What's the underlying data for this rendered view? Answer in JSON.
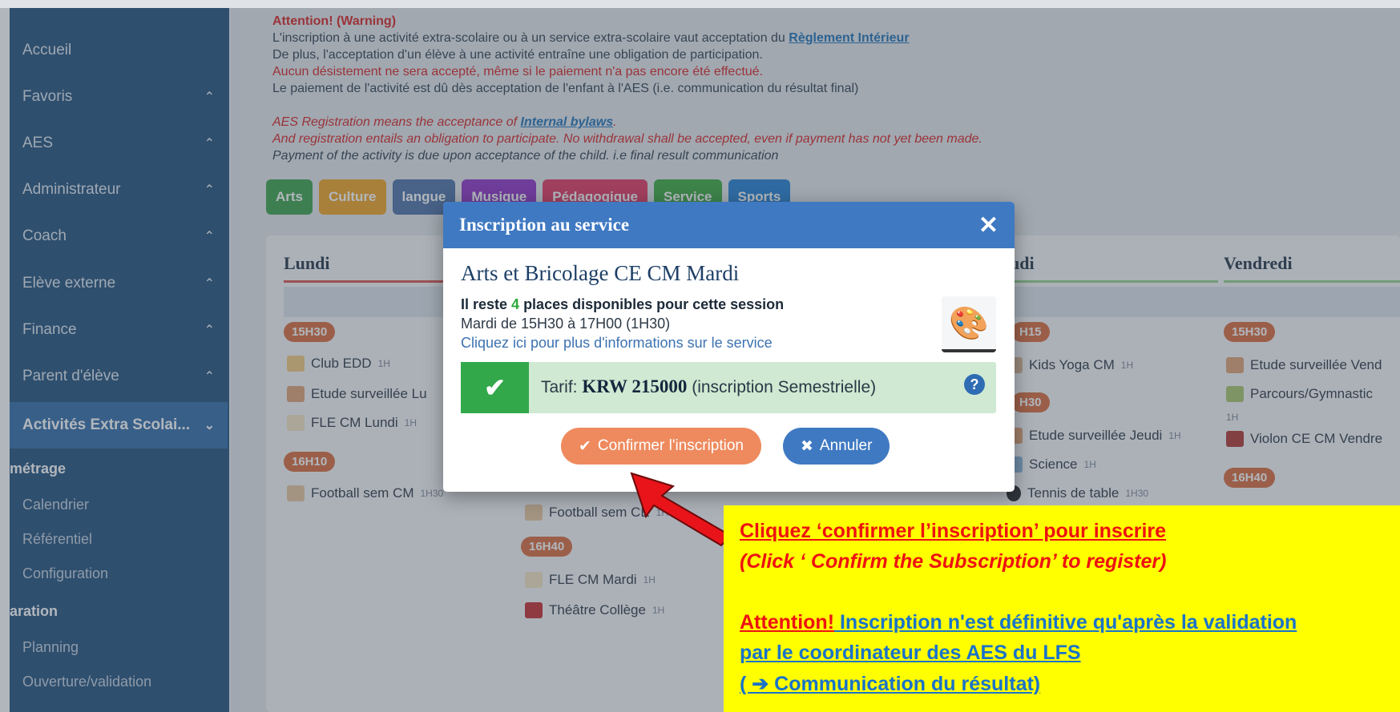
{
  "sidebar": {
    "items": [
      {
        "label": "Accueil",
        "chevron": ""
      },
      {
        "label": "Favoris",
        "chevron": "^"
      },
      {
        "label": "AES",
        "chevron": "^"
      },
      {
        "label": "Administrateur",
        "chevron": "^"
      },
      {
        "label": "Coach",
        "chevron": "^"
      },
      {
        "label": "Elève externe",
        "chevron": "^"
      },
      {
        "label": "Finance",
        "chevron": "^"
      },
      {
        "label": "Parent d'élève",
        "chevron": "^"
      },
      {
        "label": "Activités Extra Scolai...",
        "chevron": "v"
      }
    ],
    "section1": "métrage",
    "sub1": [
      "Calendrier",
      "Référentiel",
      "Configuration"
    ],
    "section2": "aration",
    "sub2": [
      "Planning",
      "Ouverture/validation"
    ]
  },
  "notice": {
    "title": "Attention! (Warning)",
    "line1": "L'inscription à une activité extra-scolaire ou à un service extra-scolaire vaut acceptation du ",
    "line1_link": "Règlement Intérieur",
    "line2": "De plus, l'acceptation d'un élève à une activité entraîne une obligation de participation.",
    "line3": "Aucun désistement ne sera accepté, même si le paiement n'a pas encore été effectué.",
    "line4": "Le paiement de l'activité est dû dès acceptation de l'enfant à l'AES (i.e. communication du résultat final)",
    "en1": "AES Registration means the acceptance of ",
    "en1_link": "Internal bylaws",
    "en1_end": ".",
    "en2": "And registration entails an obligation to participate. No withdrawal shall be accepted, even if payment has not yet been made.",
    "en3": "Payment of the activity is due upon acceptance of the child. i.e final result communication"
  },
  "tabs": [
    {
      "label": "Arts",
      "color": "#3aa047"
    },
    {
      "label": "Culture",
      "color": "#f0a21e"
    },
    {
      "label": "langue",
      "color": "#4a6fa5"
    },
    {
      "label": "Musique",
      "color": "#8e2fc4"
    },
    {
      "label": "Pédagogique",
      "color": "#e2345f"
    },
    {
      "label": "Service",
      "color": "#37a83c"
    },
    {
      "label": "Sports",
      "color": "#1f7fd3"
    }
  ],
  "schedule": {
    "lundi": "Lundi",
    "jeudi": "udi",
    "vendredi": "Vendredi",
    "times": {
      "l1": "15H30",
      "l2": "16H10",
      "m1": "16H40",
      "j1": "H15",
      "j2": "H30",
      "v1": "15H30",
      "v2": "16H40"
    },
    "activities": {
      "club_edd": "Club EDD",
      "club_edd_d": "1H",
      "etude_lu": "Etude surveillée Lu",
      "fle_lundi": "FLE CM Lundi",
      "fle_lundi_d": "1H",
      "football_lu": "Football sem CM",
      "football_lu_d": "1H30",
      "football_ma": "Football sem CE",
      "football_ma_d": "1H30",
      "fle_mardi": "FLE CM Mardi",
      "fle_mardi_d": "1H",
      "theatre": "Théâtre Collège",
      "theatre_d": "1H",
      "yoga": "Kids Yoga CM",
      "yoga_d": "1H",
      "etude_jeudi": "Etude surveillée Jeudi",
      "etude_jeudi_d": "1H",
      "science": "Science",
      "science_d": "1H",
      "tennis": "Tennis de table",
      "tennis_d": "1H30",
      "etude_vend": "Etude surveillée Vend",
      "parcours": "Parcours/Gymnastic",
      "parcours_d": "1H",
      "violon": "Violon CE CM Vendre"
    }
  },
  "modal": {
    "title": "Inscription au service",
    "service_name": "Arts et Bricolage CE CM Mardi",
    "places_pre": "Il reste ",
    "places_num": "4",
    "places_post": " places disponibles pour cette session",
    "schedule": "Mardi de 15H30 à 17H00 (1H30)",
    "info_link": "Cliquez ici pour plus d'informations sur le service",
    "tarif_label": "Tarif: ",
    "tarif_value": "KRW 215000",
    "tarif_note": " (inscription Semestrielle)",
    "help": "?",
    "confirm": "Confirmer l'inscription",
    "cancel": "Annuler"
  },
  "callout": {
    "line1": "Cliquez ‘confirmer l’inscription’ pour inscrire",
    "line2": "(Click ‘ Confirm the Subscription’ to register)",
    "line3_red": "Attention!",
    "line3_blue": " Inscription n'est définitive qu'après la validation",
    "line4": "par le coordinateur des AES du LFS",
    "line5": "( ➔ Communication du résultat)"
  },
  "colors": {
    "sidebar": "#1f4e79",
    "modal_header": "#3f79c2",
    "confirm": "#ee8a5e",
    "callout": "#ffff00"
  }
}
